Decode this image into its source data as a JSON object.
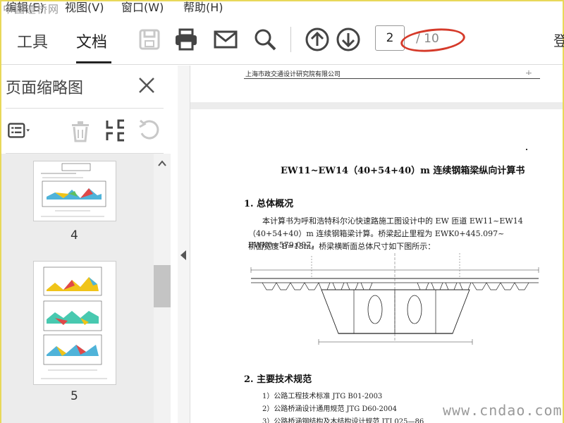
{
  "watermark_top": "中国道桥网",
  "watermark_bottom": "www.cndao.com",
  "menubar": {
    "items": [
      "编辑(E)",
      "视图(V)",
      "窗口(W)",
      "帮助(H)"
    ]
  },
  "toolbar": {
    "tabs": [
      "工具",
      "文档"
    ],
    "active_tab": "文档",
    "current_page": "2",
    "total_pages": "/ 10",
    "right_label": "登"
  },
  "sidebar": {
    "title": "页面缩略图",
    "thumbnails": [
      {
        "label": "4"
      },
      {
        "label": "5"
      }
    ]
  },
  "document": {
    "prev_header": "上海市政交通设计研究院有限公司",
    "prev_mark": "-i-",
    "title": "EW11~EW14（40+54+40）m 连续钢箱梁纵向计算书",
    "section1_title": "1.   总体概况",
    "para1_line1": "本计算书为呼和浩特科尔沁快速路施工图设计中的 EW 匝道 EW11~EW14",
    "para1_line2": "（40+54+40）m 连续钢箱梁计算。桥梁起止里程为 EWK0+445.097~ EWK0+579.097，",
    "para1_line3": "桥面宽度 B=13m。桥梁横断面总体尺寸如下图所示：",
    "section2_title": "2.   主要技术规范",
    "specs": [
      "1）公路工程技术标准 JTG B01-2003",
      "2）公路桥涵设计通用规范 JTG D60-2004",
      "3）公路桥涵钢结构及木结构设计规范 JTJ 025—86"
    ]
  },
  "colors": {
    "accent_ellipse": "#d53a2a",
    "frame": "#e8d85a"
  }
}
